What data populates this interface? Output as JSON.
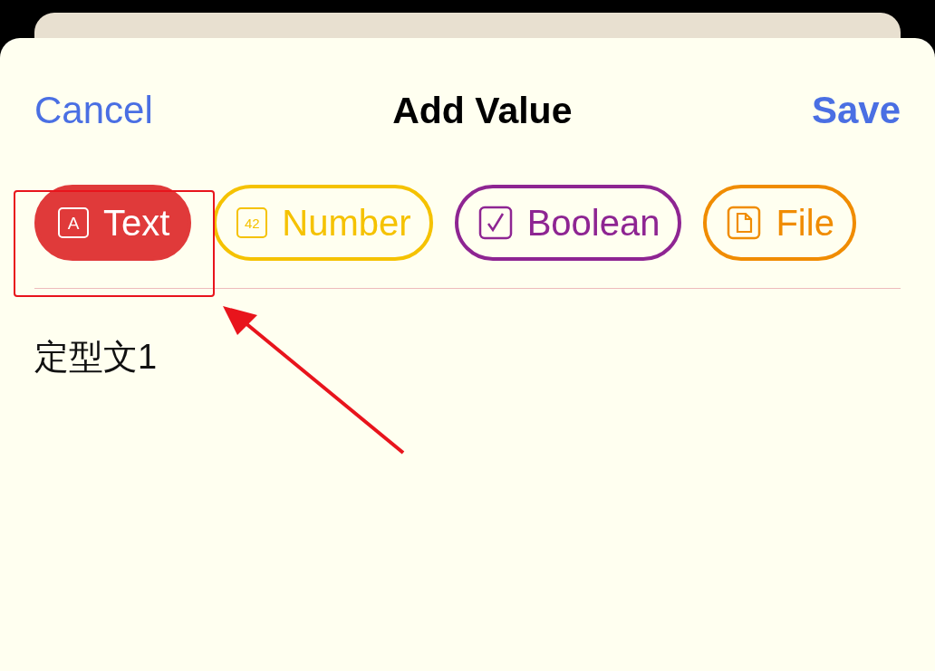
{
  "header": {
    "cancel": "Cancel",
    "title": "Add Value",
    "save": "Save"
  },
  "types": [
    {
      "label": "Text",
      "kind": "letter",
      "glyph": "A",
      "color": "#e03a3a",
      "selected": true
    },
    {
      "label": "Number",
      "kind": "letter",
      "glyph": "42",
      "color": "#f5c200",
      "selected": false
    },
    {
      "label": "Boolean",
      "kind": "check",
      "color": "#8e2592",
      "selected": false
    },
    {
      "label": "File",
      "kind": "document",
      "color": "#f08c00",
      "selected": false
    }
  ],
  "value": "定型文1",
  "annotation": {
    "highlight": true
  }
}
